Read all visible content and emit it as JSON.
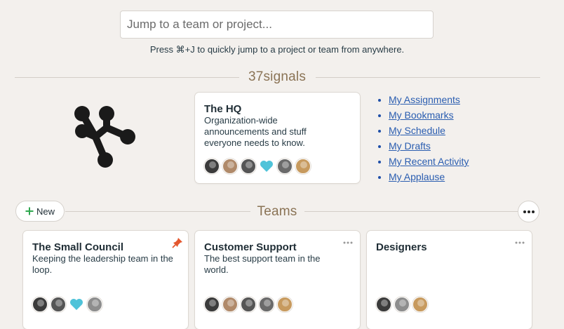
{
  "search": {
    "placeholder": "Jump to a team or project..."
  },
  "hint": "Press ⌘+J to quickly jump to a project or team from anywhere.",
  "company": {
    "name": "37signals",
    "hq": {
      "title": "The HQ",
      "description": "Organization-wide announcements and stuff everyone needs to know."
    },
    "links": [
      "My Assignments",
      "My Bookmarks",
      "My Schedule",
      "My Drafts",
      "My Recent Activity",
      "My Applause"
    ]
  },
  "teams": {
    "title": "Teams",
    "new_label": "New",
    "cards": [
      {
        "title": "The Small Council",
        "description": "Keeping the leadership team in the loop."
      },
      {
        "title": "Customer Support",
        "description": "The best support team in the world."
      },
      {
        "title": "Designers",
        "description": ""
      }
    ]
  },
  "colors": {
    "background": "#f3f0ed",
    "accent_brown": "#8a7355",
    "link": "#2a5db0",
    "heart": "#4fc3d9",
    "pin": "#e4572e",
    "plus": "#2fa84f"
  },
  "icons": {
    "logo": "37signals-logo",
    "pin": "pin-icon",
    "heart": "heart-icon",
    "plus": "plus-icon",
    "more": "more-icon"
  }
}
